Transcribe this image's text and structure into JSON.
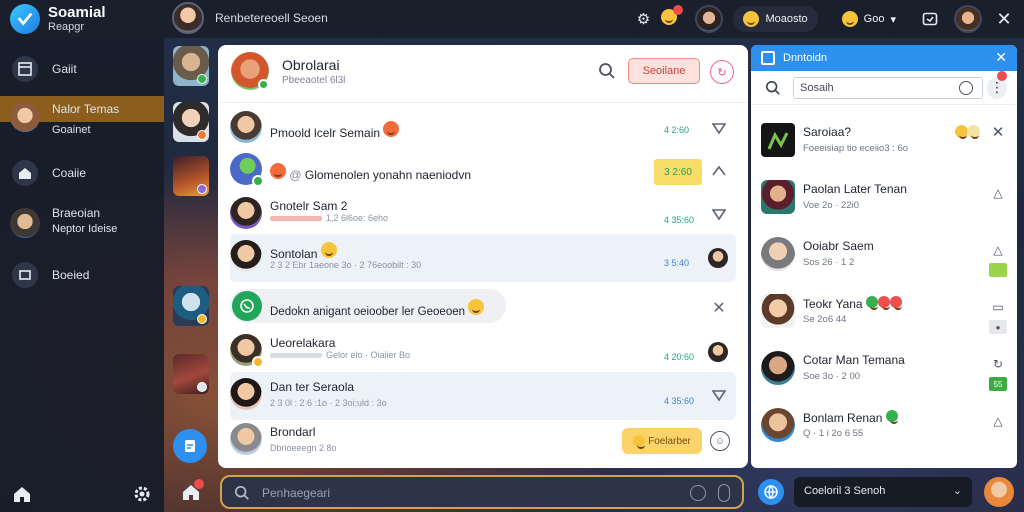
{
  "topbar": {
    "brand_title": "Soamial",
    "brand_subtitle": "Reapgr",
    "window_title": "Renbetereoell Seoen",
    "status_text": "Moaosto",
    "user_text": "Goo"
  },
  "sidebar": {
    "items": [
      {
        "label": "Gaiit"
      },
      {
        "label": "Nalor Temas",
        "sublabel": "Goainet"
      },
      {
        "label": "Coaiie"
      },
      {
        "label": "Braeoian",
        "sublabel": "Neptor Ideise"
      },
      {
        "label": "Boeied"
      }
    ]
  },
  "chat_header": {
    "name": "Obrolarai",
    "subtitle": "Pbeeaotel 6l3l",
    "action_button": "Seoilane"
  },
  "messages": [
    {
      "name": "Pmoold lcelr Semain",
      "preview": "",
      "time": "4 2:60"
    },
    {
      "name": "Glomenolen yonahn naeniodvn",
      "preview": "",
      "tag": "3 2:60"
    },
    {
      "name": "Gnotelr Sam 2",
      "preview": "1,2 6l6oe: 6eho",
      "time": "4 35:60"
    },
    {
      "name": "Sontolan",
      "preview": "2 3 2 Ebr 1aeone 3o · 2 76eoobilt : 30",
      "time": "3 5:40"
    },
    {
      "name": "Dedokn anigant oeioober ler Geoeoen",
      "preview": ""
    },
    {
      "name": "Ueorelakara",
      "preview": "Gelor elo · Oiaiier Bo",
      "time": "4 20:60"
    },
    {
      "name": "Dan ter Seraola",
      "preview": "2 3 0l : 2 6 :1o · 2 3oi;uld : 3o",
      "time": "4 35:60"
    },
    {
      "name": "Brondarl",
      "preview": "Dbrioeeegn 2 8o",
      "button": "Foelarber"
    }
  ],
  "compose": {
    "placeholder": "Penhaegeari"
  },
  "right_panel": {
    "title": "Dnntoidn",
    "search_value": "Sosaih",
    "items": [
      {
        "name": "Saroiaa?",
        "sub": "Foeeisiap tio eceiio3 : 6o"
      },
      {
        "name": "Paolan Later Tenan",
        "sub": "Voe 2o · 22i0"
      },
      {
        "name": "Ooiabr Saem",
        "sub": "Sos 26 · 1 2"
      },
      {
        "name": "Teokr Yana",
        "sub": "Se 2o6 44"
      },
      {
        "name": "Cotar Man Temana",
        "sub": "Soe 3o · 2 00",
        "badge": "55"
      },
      {
        "name": "Bonlam Renan",
        "sub": "Q · 1 i 2o 6 55"
      }
    ]
  },
  "bottom": {
    "pill_text": "Coeloril 3 Senoh"
  },
  "colors": {
    "accent_blue": "#2d90ec",
    "nav_active": "#8c5e1d",
    "compose_border": "#d2a24d",
    "online_green": "#33b24a"
  },
  "icons": [
    "search-icon",
    "close-icon",
    "gear-icon",
    "home-icon",
    "chevron-down-icon",
    "more-icon",
    "mic-icon",
    "emoji-icon"
  ]
}
